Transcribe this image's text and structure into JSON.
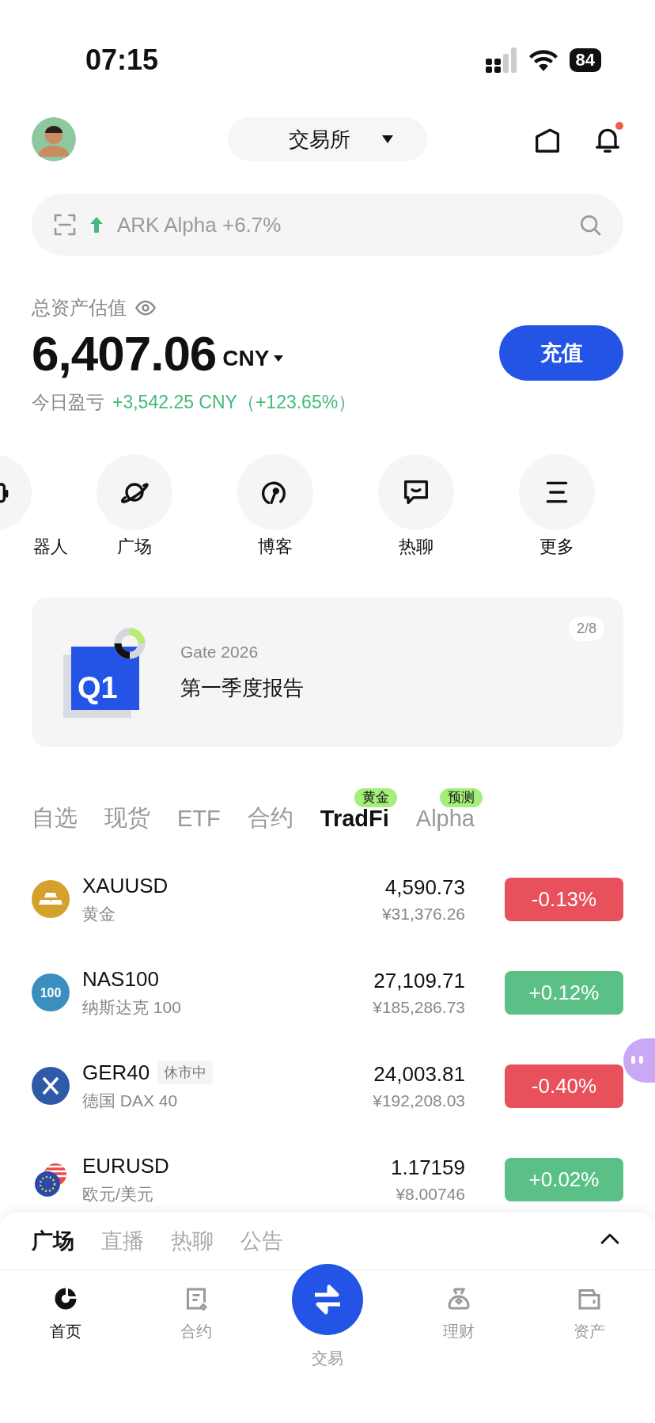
{
  "status_bar": {
    "time": "07:15",
    "battery": "84"
  },
  "header": {
    "exchange_selector": "交易所",
    "notification_dot": true
  },
  "search": {
    "placeholder": "ARK Alpha +6.7%"
  },
  "assets": {
    "label": "总资产估值",
    "amount": "6,407.06",
    "currency": "CNY",
    "pnl_label": "今日盈亏",
    "pnl_value": "+3,542.25 CNY（+123.65%）",
    "deposit_button": "充值"
  },
  "shortcuts": [
    {
      "label": "器人"
    },
    {
      "label": "广场"
    },
    {
      "label": "博客"
    },
    {
      "label": "热聊"
    },
    {
      "label": "更多"
    }
  ],
  "banner": {
    "subtitle": "Gate 2026",
    "title": "第一季度报告",
    "icon_text": "Q1",
    "page": "2/8"
  },
  "market_tabs": [
    {
      "label": "自选",
      "selected": false
    },
    {
      "label": "现货",
      "selected": false
    },
    {
      "label": "ETF",
      "selected": false
    },
    {
      "label": "合约",
      "selected": false
    },
    {
      "label": "TradFi",
      "selected": true,
      "tag": "黄金"
    },
    {
      "label": "Alpha",
      "selected": false,
      "tag": "预测"
    }
  ],
  "markets": [
    {
      "symbol": "XAUUSD",
      "name": "黄金",
      "price": "4,590.73",
      "price_cny": "¥31,376.26",
      "change": "-0.13%",
      "color": "#e8505b"
    },
    {
      "symbol": "NAS100",
      "name": "纳斯达克 100",
      "icon_text": "100",
      "price": "27,109.71",
      "price_cny": "¥185,286.73",
      "change": "+0.12%",
      "color": "#5bc086"
    },
    {
      "symbol": "GER40",
      "status_tag": "休市中",
      "name": "德国 DAX 40",
      "price": "24,003.81",
      "price_cny": "¥192,208.03",
      "change": "-0.40%",
      "color": "#e8505b"
    },
    {
      "symbol": "EURUSD",
      "name": "欧元/美元",
      "price": "1.17159",
      "price_cny": "¥8.00746",
      "change": "+0.02%",
      "color": "#5bc086"
    }
  ],
  "sheet": {
    "tabs": [
      {
        "label": "广场",
        "selected": true
      },
      {
        "label": "直播",
        "selected": false
      },
      {
        "label": "热聊",
        "selected": false
      },
      {
        "label": "公告",
        "selected": false
      }
    ]
  },
  "nav": [
    {
      "label": "首页",
      "selected": true
    },
    {
      "label": "合约",
      "selected": false
    },
    {
      "label": "交易",
      "selected": false
    },
    {
      "label": "理财",
      "selected": false
    },
    {
      "label": "资产",
      "selected": false
    }
  ]
}
